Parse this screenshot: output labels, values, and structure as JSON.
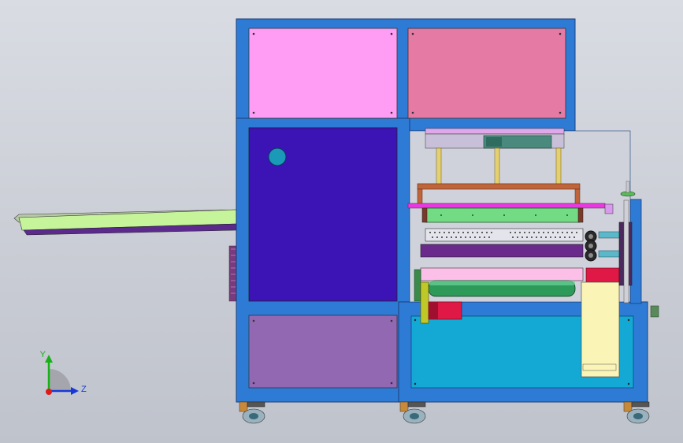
{
  "axes": {
    "y_label": "Y",
    "z_label": "Z",
    "y_color": "#18b018",
    "z_color": "#1838d8",
    "origin_color": "#e01818"
  },
  "colors": {
    "background": "#cfd2da",
    "frame_blue": "#2e7bd6",
    "panel_pink": "#ff9cf4",
    "panel_rose": "#e57aa4",
    "panel_indigo": "#3c13b5",
    "panel_lilac": "#9368b3",
    "tank_cyan": "#14a8d4",
    "conveyor_green": "#c6f49a",
    "roller_green": "#72db84",
    "motor_red": "#e01846",
    "cream_block": "#faf4b6"
  }
}
